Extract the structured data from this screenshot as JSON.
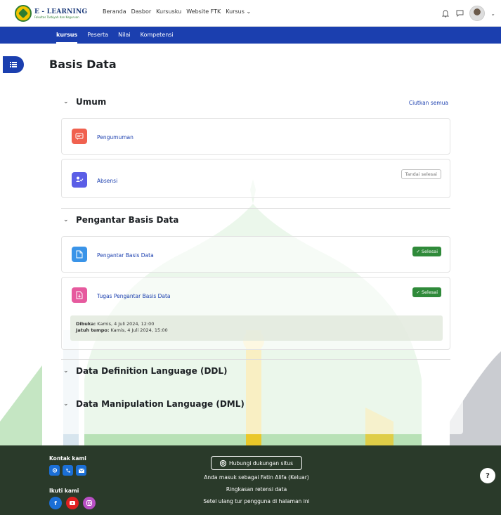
{
  "header": {
    "logo_title": "E - LEARNING",
    "logo_subtitle": "Fakultas Tarbiyah dan Keguruan",
    "nav": [
      "Beranda",
      "Dasbor",
      "Kursusku",
      "Website FTK",
      "Kursus"
    ],
    "icons": [
      "bell-icon",
      "chat-icon",
      "avatar",
      "chevron-down-icon"
    ]
  },
  "secondary_nav": {
    "tabs": [
      "kursus",
      "Peserta",
      "Nilai",
      "Kompetensi"
    ],
    "active": "kursus"
  },
  "page": {
    "title": "Basis Data"
  },
  "sections": [
    {
      "title": "Umum",
      "collapse_all": "Ciutkan semua",
      "activities": [
        {
          "label": "Pengumuman",
          "icon": "forum-icon",
          "color": "#f0614f"
        },
        {
          "label": "Absensi",
          "icon": "attendance-icon",
          "color": "#5b5ee6",
          "button": "Tandai selesai"
        }
      ]
    },
    {
      "title": "Pengantar Basis Data",
      "activities": [
        {
          "label": "Pengantar Basis Data",
          "icon": "file-icon",
          "color": "#3a94e8",
          "status": "Selesai"
        },
        {
          "label": "Tugas Pengantar Basis Data",
          "icon": "assignment-icon",
          "color": "#e65a9e",
          "status": "Selesai",
          "opened_label": "Dibuka:",
          "opened_value": "Kamis, 4 Juli 2024, 12:00",
          "due_label": "Jatuh tempo:",
          "due_value": "Kamis, 4 Juli 2024, 15:00"
        }
      ]
    },
    {
      "title": "Data Definition Language (DDL)"
    },
    {
      "title": "Data Manipulation Language (DML)"
    }
  ],
  "footer": {
    "contact_label": "Kontak kami",
    "follow_label": "Ikuti kami",
    "support_button": "Hubungi dukungan situs",
    "logged_in": "Anda masuk sebagai Fatin Alifa (Keluar)",
    "retention": "Ringkasan retensi data",
    "reset_tour": "Setel ulang tur pengguna di halaman ini",
    "help": "?"
  },
  "colors": {
    "primary": "#1b3faf",
    "success": "#2f8a3a",
    "footer_bg": "#2a3a2a"
  }
}
